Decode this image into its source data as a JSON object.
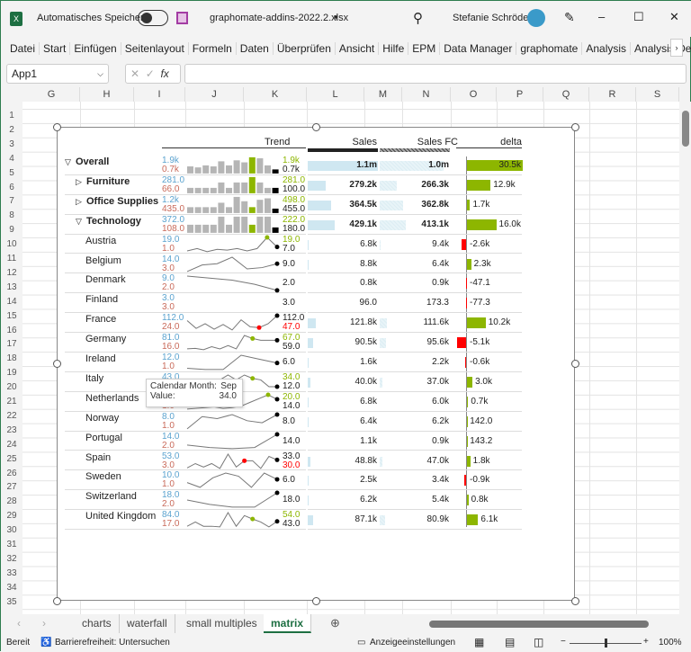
{
  "window": {
    "autosave_label": "Automatisches Speichern",
    "filename": "graphomate-addins-2022.2.xlsx",
    "user": "Stefanie Schröder",
    "minimize": "–",
    "maximize": "☐",
    "close": "✕"
  },
  "ribbon": [
    "Datei",
    "Start",
    "Einfügen",
    "Seitenlayout",
    "Formeln",
    "Daten",
    "Überprüfen",
    "Ansicht",
    "Hilfe",
    "EPM",
    "Data Manager",
    "graphomate",
    "Analysis",
    "Analysis Design"
  ],
  "formula_bar": {
    "name_box": "App1",
    "value": ""
  },
  "columns": [
    "G",
    "H",
    "I",
    "J",
    "K",
    "L",
    "M",
    "N",
    "O",
    "P",
    "Q",
    "R",
    "S"
  ],
  "rows_count": 35,
  "matrix": {
    "headers": {
      "trend": "Trend",
      "sales": "Sales",
      "sales_fc": "Sales FC",
      "delta": "delta"
    },
    "colors": {
      "max": "#5ba3cf",
      "min": "#c96a5a",
      "highlight": "#8db600",
      "negative": "#ff0000",
      "sales_bar": "#cfe7f1",
      "fc_bar": "#e8f4f8",
      "bars": "#b5b5b5"
    },
    "rows": [
      {
        "label": "Overall",
        "level": 0,
        "expand": "▽",
        "type": "bar",
        "max": "1.9k",
        "min": "0.7k",
        "last_hi": "1.9k",
        "last": "0.7k",
        "last_hi_color": "green",
        "spark": [
          7,
          6,
          8,
          7,
          12,
          8,
          13,
          11,
          16,
          15,
          8,
          4
        ],
        "hi": 8,
        "sales": "1.1m",
        "sales_v": 1100,
        "fc": "1.0m",
        "fc_v": 1000,
        "delta": "30.5k",
        "delta_v": 30.5,
        "bold": true
      },
      {
        "label": "Furniture",
        "level": 1,
        "expand": "▷",
        "type": "bar",
        "max": "281.0",
        "min": "66.0",
        "last_hi": "281.0",
        "last": "100.0",
        "last_hi_color": "green",
        "spark": [
          1,
          1,
          1,
          1,
          2,
          1,
          2,
          2,
          3,
          2,
          1,
          1
        ],
        "hi": 8,
        "sales": "279.2k",
        "sales_v": 279.2,
        "fc": "266.3k",
        "fc_v": 266.3,
        "delta": "12.9k",
        "delta_v": 12.9,
        "bold": true
      },
      {
        "label": "Office Supplies",
        "level": 1,
        "expand": "▷",
        "type": "bar",
        "max": "1.2k",
        "min": "435.0",
        "last_hi": "498.0",
        "last": "455.0",
        "last_hi_color": "green",
        "spark": [
          4,
          4,
          4,
          4,
          7,
          4,
          11,
          8,
          4,
          9,
          10,
          3
        ],
        "hi": 8,
        "sales": "364.5k",
        "sales_v": 364.5,
        "fc": "362.8k",
        "fc_v": 362.8,
        "delta": "1.7k",
        "delta_v": 1.7,
        "bold": true
      },
      {
        "label": "Technology",
        "level": 1,
        "expand": "▽",
        "type": "bar",
        "max": "372.0",
        "min": "108.0",
        "last_hi": "222.0",
        "last": "180.0",
        "last_hi_color": "green",
        "spark": [
          1,
          1,
          1,
          1,
          2,
          1,
          2,
          2,
          1,
          2,
          2,
          1
        ],
        "hi": 8,
        "sales": "429.1k",
        "sales_v": 429.1,
        "fc": "413.1k",
        "fc_v": 413.1,
        "delta": "16.0k",
        "delta_v": 16.0,
        "bold": true
      },
      {
        "label": "Austria",
        "level": 2,
        "type": "line",
        "max": "19.0",
        "min": "1.0",
        "last_hi": "19.0",
        "last": "7.0",
        "last_hi_color": "green",
        "spark": [
          2,
          5,
          1,
          4,
          3,
          5,
          2,
          5,
          19,
          7
        ],
        "hi": 8,
        "sales": "6.8k",
        "sales_v": 6.8,
        "fc": "9.4k",
        "fc_v": 9.4,
        "delta": "-2.6k",
        "delta_v": -2.6
      },
      {
        "label": "Belgium",
        "level": 2,
        "type": "line",
        "max": "14.0",
        "min": "3.0",
        "last": "9.0",
        "spark": [
          3,
          8,
          9,
          14,
          5,
          6,
          9
        ],
        "hi": -1,
        "sales": "8.8k",
        "sales_v": 8.8,
        "fc": "6.4k",
        "fc_v": 6.4,
        "delta": "2.3k",
        "delta_v": 2.3
      },
      {
        "label": "Denmark",
        "level": 2,
        "type": "line",
        "max": "9.0",
        "min": "2.0",
        "last": "2.0",
        "spark": [
          9,
          8,
          7,
          5,
          2
        ],
        "hi": -1,
        "sales": "0.8k",
        "sales_v": 0.8,
        "fc": "0.9k",
        "fc_v": 0.9,
        "delta": "-47.1",
        "delta_v": -0.05
      },
      {
        "label": "Finland",
        "level": 2,
        "type": "line",
        "max": "3.0",
        "min": "3.0",
        "last": "3.0",
        "spark": [],
        "hi": -1,
        "sales": "96.0",
        "sales_v": 0.1,
        "fc": "173.3",
        "fc_v": 0.17,
        "delta": "-77.3",
        "delta_v": -0.08
      },
      {
        "label": "France",
        "level": 2,
        "type": "line",
        "max": "112.0",
        "min": "24.0",
        "last_hi": "112.0",
        "last": "47.0",
        "last_color": "red",
        "spark": [
          80,
          30,
          60,
          25,
          55,
          20,
          85,
          40,
          35,
          60,
          112
        ],
        "hi": 8,
        "hi_color": "red",
        "sales": "121.8k",
        "sales_v": 121.8,
        "fc": "111.6k",
        "fc_v": 111.6,
        "delta": "10.2k",
        "delta_v": 10.2
      },
      {
        "label": "Germany",
        "level": 2,
        "type": "line",
        "max": "81.0",
        "min": "16.0",
        "last_hi": "67.0",
        "last": "59.0",
        "last_hi_color": "green",
        "spark": [
          20,
          22,
          16,
          30,
          20,
          35,
          20,
          81,
          67,
          59,
          59,
          59
        ],
        "hi": 8,
        "sales": "90.5k",
        "sales_v": 90.5,
        "fc": "95.6k",
        "fc_v": 95.6,
        "delta": "-5.1k",
        "delta_v": -5.1
      },
      {
        "label": "Ireland",
        "level": 2,
        "type": "line",
        "max": "12.0",
        "min": "1.0",
        "last": "6.0",
        "spark": [
          2,
          1,
          1,
          12,
          9,
          6
        ],
        "hi": -1,
        "sales": "1.6k",
        "sales_v": 1.6,
        "fc": "2.2k",
        "fc_v": 2.2,
        "delta": "-0.6k",
        "delta_v": -0.6
      },
      {
        "label": "Italy",
        "level": 2,
        "type": "line",
        "max": "43.0",
        "min": "1.0",
        "last_hi": "34.0",
        "last": "12.0",
        "last_hi_color": "green",
        "spark": [
          5,
          15,
          10,
          20,
          30,
          43,
          30,
          43,
          34,
          30,
          12,
          12
        ],
        "hi": 8,
        "sales": "40.0k",
        "sales_v": 40.0,
        "fc": "37.0k",
        "fc_v": 37.0,
        "delta": "3.0k",
        "delta_v": 3.0
      },
      {
        "label": "Netherlands",
        "level": 2,
        "type": "line",
        "max": "20.0",
        "min": "1.0",
        "last_hi": "20.0",
        "last": "14.0",
        "last_hi_color": "green",
        "spark": [
          1,
          2,
          3,
          4,
          2,
          3,
          5,
          10,
          15,
          20,
          14
        ],
        "hi": 9,
        "sales": "6.8k",
        "sales_v": 6.8,
        "fc": "6.0k",
        "fc_v": 6.0,
        "delta": "0.7k",
        "delta_v": 0.7
      },
      {
        "label": "Norway",
        "level": 2,
        "type": "line",
        "max": "8.0",
        "min": "1.0",
        "last": "8.0",
        "spark": [
          1,
          7,
          6,
          8,
          5,
          4,
          8
        ],
        "hi": -1,
        "sales": "6.4k",
        "sales_v": 6.4,
        "fc": "6.2k",
        "fc_v": 6.2,
        "delta": "142.0",
        "delta_v": 0.14
      },
      {
        "label": "Portugal",
        "level": 2,
        "type": "line",
        "max": "14.0",
        "min": "2.0",
        "last": "14.0",
        "spark": [
          5,
          3,
          2,
          3,
          14
        ],
        "hi": -1,
        "sales": "1.1k",
        "sales_v": 1.1,
        "fc": "0.9k",
        "fc_v": 0.9,
        "delta": "143.2",
        "delta_v": 0.14
      },
      {
        "label": "Spain",
        "level": 2,
        "type": "line",
        "max": "53.0",
        "min": "3.0",
        "last_hi": "33.0",
        "last": "30.0",
        "last_color": "red",
        "spark": [
          5,
          20,
          8,
          20,
          3,
          53,
          8,
          30,
          30,
          3,
          45,
          33
        ],
        "hi": 7,
        "hi_color": "red",
        "sales": "48.8k",
        "sales_v": 48.8,
        "fc": "47.0k",
        "fc_v": 47.0,
        "delta": "1.8k",
        "delta_v": 1.8
      },
      {
        "label": "Sweden",
        "level": 2,
        "type": "line",
        "max": "10.0",
        "min": "1.0",
        "last": "6.0",
        "spark": [
          4,
          1,
          7,
          10,
          8,
          1,
          10,
          6
        ],
        "hi": -1,
        "sales": "2.5k",
        "sales_v": 2.5,
        "fc": "3.4k",
        "fc_v": 3.4,
        "delta": "-0.9k",
        "delta_v": -0.9
      },
      {
        "label": "Switzerland",
        "level": 2,
        "type": "line",
        "max": "18.0",
        "min": "2.0",
        "last": "18.0",
        "spark": [
          10,
          5,
          2,
          2,
          18
        ],
        "hi": -1,
        "sales": "6.2k",
        "sales_v": 6.2,
        "fc": "5.4k",
        "fc_v": 5.4,
        "delta": "0.8k",
        "delta_v": 0.8
      },
      {
        "label": "United Kingdom",
        "level": 2,
        "type": "line",
        "max": "84.0",
        "min": "17.0",
        "last_hi": "54.0",
        "last": "43.0",
        "last_hi_color": "green",
        "spark": [
          20,
          40,
          20,
          20,
          17,
          84,
          20,
          70,
          54,
          40,
          17,
          43
        ],
        "hi": 8,
        "sales": "87.1k",
        "sales_v": 87.1,
        "fc": "80.9k",
        "fc_v": 80.9,
        "delta": "6.1k",
        "delta_v": 6.1
      }
    ]
  },
  "tooltip": {
    "k1": "Calendar Month:",
    "v1": "Sep",
    "k2": "Value:",
    "v2": "34.0"
  },
  "sheets": {
    "tabs": [
      "charts",
      "waterfall",
      "small multiples",
      "matrix"
    ],
    "active": "matrix"
  },
  "status": {
    "ready": "Bereit",
    "accessibility": "Barrierefreiheit: Untersuchen",
    "display": "Anzeigeeinstellungen",
    "zoom": "100%",
    "zoom_level": 100
  }
}
